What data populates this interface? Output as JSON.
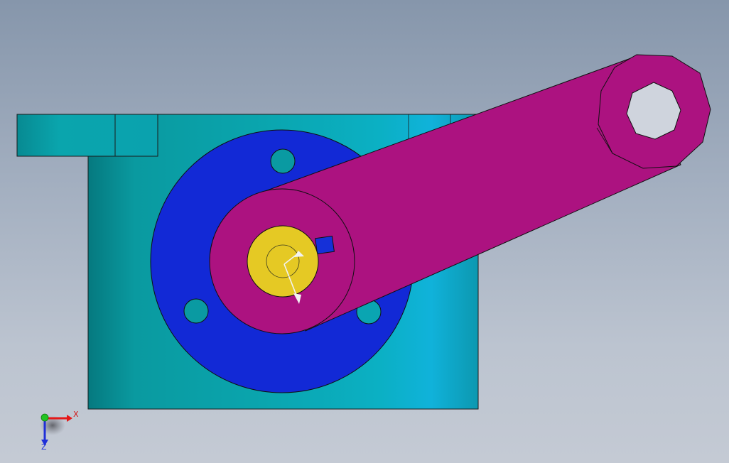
{
  "viewport": {
    "background_top": "#8696ab",
    "background_bottom": "#c4cad4"
  },
  "model": {
    "colors": {
      "base_block": "#0aa6b4",
      "flange": "#1229d6",
      "arm": "#ac1280",
      "shaft": "#e5c924",
      "key": "#1530d8",
      "edge": "#1a1a1a"
    }
  },
  "triad": {
    "x_label": "X",
    "z_label": "Z",
    "x_color": "#e51818",
    "y_color": "#22c422",
    "z_color": "#1f2fd8"
  }
}
